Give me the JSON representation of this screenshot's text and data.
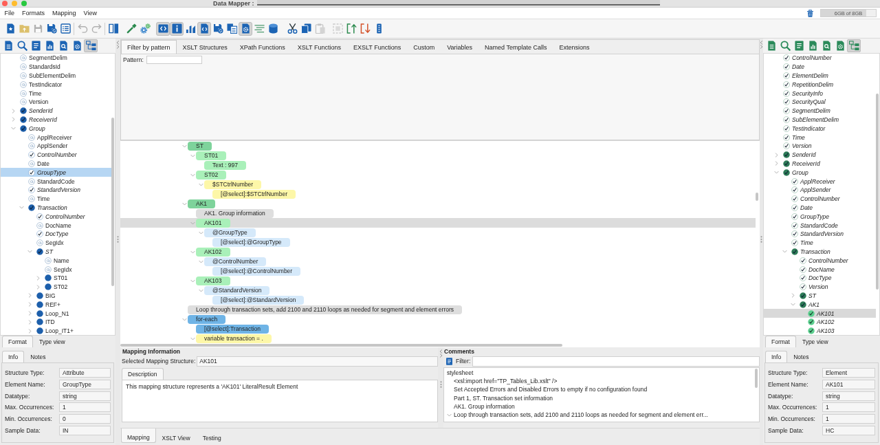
{
  "window": {
    "title": "Data Mapper :"
  },
  "menu": [
    "File",
    "Formats",
    "Mapping",
    "View"
  ],
  "memory": {
    "level": 0.82,
    "reading": "6GB of 8GB"
  },
  "toolbar": [
    {
      "on": false,
      "disabled": false
    },
    {
      "on": false,
      "disabled": false
    },
    {
      "on": false,
      "disabled": true
    },
    {
      "on": false,
      "disabled": false
    },
    {
      "on": false,
      "disabled": false
    },
    {
      "on": false,
      "disabled": true
    },
    {
      "on": false,
      "disabled": true
    },
    {
      "on": false,
      "disabled": false
    },
    {
      "on": false,
      "disabled": false
    },
    {
      "on": false,
      "disabled": false
    },
    {
      "on": true,
      "disabled": false
    },
    {
      "on": true,
      "disabled": false
    },
    {
      "on": false,
      "disabled": false
    },
    {
      "on": true,
      "disabled": false
    },
    {
      "on": false,
      "disabled": false
    },
    {
      "on": false,
      "disabled": false
    },
    {
      "on": true,
      "disabled": false
    },
    {
      "on": false,
      "disabled": false
    },
    {
      "on": false,
      "disabled": false
    },
    {
      "on": false,
      "disabled": false
    },
    {
      "on": false,
      "disabled": false
    },
    {
      "on": false,
      "disabled": true
    },
    {
      "on": false,
      "disabled": true
    },
    {
      "on": false,
      "disabled": false
    },
    {
      "on": false,
      "disabled": false
    },
    {
      "on": false,
      "disabled": false
    }
  ],
  "source_panel": {
    "tools": [
      {
        "on": false
      },
      {
        "on": false
      },
      {
        "on": false
      },
      {
        "on": false
      },
      {
        "on": false
      },
      {
        "on": false
      },
      {
        "on": true
      }
    ],
    "tree": [
      {
        "label": "SegmentDelim",
        "kind": "attribute",
        "selected": false
      },
      {
        "label": "StandardsId",
        "kind": "attribute",
        "selected": false
      },
      {
        "label": "SubElementDelim",
        "kind": "attribute",
        "selected": false
      },
      {
        "label": "TestIndicator",
        "kind": "attribute",
        "selected": false
      },
      {
        "label": "Time",
        "kind": "attribute",
        "selected": false
      },
      {
        "label": "Version",
        "kind": "attribute",
        "selected": false
      },
      {
        "label": "SenderId",
        "kind": "mapped-element",
        "expanded": false,
        "selected": false
      },
      {
        "label": "ReceiverId",
        "kind": "mapped-element",
        "expanded": false,
        "selected": false
      },
      {
        "label": "Group",
        "kind": "mapped-element",
        "expanded": true,
        "selected": false,
        "children": [
          {
            "label": "ApplReceiver",
            "kind": "attribute",
            "selected": false
          },
          {
            "label": "ApplSender",
            "kind": "attribute",
            "selected": false
          },
          {
            "label": "ControlNumber",
            "kind": "mapped-attribute",
            "selected": false
          },
          {
            "label": "Date",
            "kind": "attribute",
            "selected": false
          },
          {
            "label": "GroupType",
            "kind": "mapped-attribute",
            "selected": true
          },
          {
            "label": "StandardCode",
            "kind": "attribute",
            "selected": false
          },
          {
            "label": "StandardVersion",
            "kind": "mapped-attribute",
            "selected": false
          },
          {
            "label": "Time",
            "kind": "attribute",
            "selected": false
          },
          {
            "label": "Transaction",
            "kind": "mapped-element",
            "expanded": true,
            "selected": false,
            "children": [
              {
                "label": "ControlNumber",
                "kind": "mapped-attribute",
                "selected": false
              },
              {
                "label": "DocName",
                "kind": "attribute",
                "selected": false
              },
              {
                "label": "DocType",
                "kind": "mapped-attribute",
                "selected": false
              },
              {
                "label": "SegIdx",
                "kind": "attribute",
                "selected": false
              },
              {
                "label": "ST",
                "kind": "mapped-element",
                "expanded": true,
                "selected": false,
                "children": [
                  {
                    "label": "Name",
                    "kind": "attribute",
                    "selected": false
                  },
                  {
                    "label": "SegIdx",
                    "kind": "attribute",
                    "selected": false
                  },
                  {
                    "label": "ST01",
                    "kind": "element",
                    "expanded": false,
                    "selected": false
                  },
                  {
                    "label": "ST02",
                    "kind": "element",
                    "expanded": false,
                    "selected": false
                  }
                ]
              },
              {
                "label": "BIG",
                "kind": "element",
                "expanded": false,
                "selected": false
              },
              {
                "label": "REF+",
                "kind": "element",
                "expanded": false,
                "selected": false
              },
              {
                "label": "Loop_N1",
                "kind": "element",
                "expanded": false,
                "selected": false
              },
              {
                "label": "ITD",
                "kind": "element",
                "expanded": false,
                "selected": false
              },
              {
                "label": "Loop_IT1+",
                "kind": "element",
                "expanded": false,
                "selected": false
              }
            ]
          }
        ]
      }
    ],
    "view_tabs": [
      {
        "label": "Format",
        "selected": true
      },
      {
        "label": "Type view",
        "selected": false
      }
    ],
    "info_tabs": [
      {
        "label": "Info",
        "selected": true
      },
      {
        "label": "Notes",
        "selected": false
      }
    ],
    "properties": [
      {
        "label": "Structure Type:",
        "value": "Attribute"
      },
      {
        "label": "Element Name:",
        "value": "GroupType"
      },
      {
        "label": "Datatype:",
        "value": "string"
      },
      {
        "label": "Max. Occurrences:",
        "value": "1"
      },
      {
        "label": "Min. Occurrences:",
        "value": "0"
      },
      {
        "label": "Sample Data:",
        "value": "IN"
      }
    ]
  },
  "palette": {
    "tabs": [
      {
        "label": "Filter by pattern",
        "selected": true
      },
      {
        "label": "XSLT Structures",
        "selected": false
      },
      {
        "label": "XPath Functions",
        "selected": false
      },
      {
        "label": "XSLT Functions",
        "selected": false
      },
      {
        "label": "EXSLT Functions",
        "selected": false
      },
      {
        "label": "Custom",
        "selected": false
      },
      {
        "label": "Variables",
        "selected": false
      },
      {
        "label": "Named Template Calls",
        "selected": false
      },
      {
        "label": "Extensions",
        "selected": false
      }
    ],
    "pattern_label": "Pattern:"
  },
  "mapping": {
    "nodes": [
      {
        "label": "ST",
        "color": "#7ed39b",
        "expanded": true,
        "selected": false,
        "children": [
          {
            "label": "ST01",
            "color": "#a9f0b9",
            "expanded": true,
            "selected": false,
            "children": [
              {
                "label": "Text : 997",
                "color": "#a9f0b9",
                "selected": false
              }
            ]
          },
          {
            "label": "ST02",
            "color": "#a9f0b9",
            "expanded": true,
            "selected": false,
            "children": [
              {
                "label": "$STCtrlNumber",
                "color": "#fdf7a8",
                "expanded": true,
                "selected": false,
                "children": [
                  {
                    "label": "[@select]:$STCtrlNumber",
                    "color": "#fdf7a8",
                    "selected": false
                  }
                ]
              }
            ]
          }
        ]
      },
      {
        "label": "AK1",
        "color": "#7ed39b",
        "expanded": true,
        "selected": false,
        "children": [
          {
            "label": "AK1. Group information",
            "color": "#dedede",
            "selected": false
          },
          {
            "label": "AK101",
            "color": "#a9f0b9",
            "expanded": true,
            "selected": true,
            "children": [
              {
                "label": "@GroupType",
                "color": "#d5e9fa",
                "expanded": true,
                "selected": false,
                "children": [
                  {
                    "label": "[@select]:@GroupType",
                    "color": "#d5e9fa",
                    "selected": false
                  }
                ]
              }
            ]
          },
          {
            "label": "AK102",
            "color": "#a9f0b9",
            "expanded": true,
            "selected": false,
            "children": [
              {
                "label": "@ControlNumber",
                "color": "#d5e9fa",
                "expanded": true,
                "selected": false,
                "children": [
                  {
                    "label": "[@select]:@ControlNumber",
                    "color": "#d5e9fa",
                    "selected": false
                  }
                ]
              }
            ]
          },
          {
            "label": "AK103",
            "color": "#a9f0b9",
            "expanded": true,
            "selected": false,
            "children": [
              {
                "label": "@StandardVersion",
                "color": "#d5e9fa",
                "expanded": true,
                "selected": false,
                "children": [
                  {
                    "label": "[@select]:@StandardVersion",
                    "color": "#d5e9fa",
                    "selected": false
                  }
                ]
              }
            ]
          }
        ]
      },
      {
        "label": "Loop through transaction sets, add 2100 and 2110 loops as needed for segment and element errors",
        "color": "#dedede",
        "selected": false
      },
      {
        "label": "for-each",
        "color": "#6fb4e6",
        "expanded": true,
        "selected": false,
        "children": [
          {
            "label": "[@select]:Transaction",
            "color": "#6fb4e6",
            "selected": false
          },
          {
            "label": "variable transaction = .",
            "color": "#fdf7a8",
            "expanded": true,
            "selected": false
          }
        ]
      }
    ]
  },
  "mapping_info": {
    "title": "Mapping Information",
    "structure_label": "Selected Mapping Structure:",
    "structure": "AK101",
    "tabs": [
      {
        "label": "Description",
        "selected": true
      }
    ],
    "description": "This mapping structure represents a 'AK101' LiteralResult Element"
  },
  "comments": {
    "title": "Comments",
    "filter_label": "Filter:",
    "items": [
      {
        "label": "stylesheet",
        "selected": false,
        "children": [
          {
            "label": "<xsl:import href=\"TP_Tables_Lib.xslt\" />",
            "selected": false
          },
          {
            "label": "Set Accepted Errors and Disabled Errors to empty if no configuration found",
            "selected": false
          },
          {
            "label": "Part 1, ST. Transaction set information",
            "selected": false
          },
          {
            "label": "AK1. Group information",
            "selected": false
          },
          {
            "label": "Loop through transaction sets, add 2100 and 2110 loops as needed for segment and element err...",
            "expanded": true,
            "selected": false
          }
        ]
      }
    ]
  },
  "bottom_tabs": [
    {
      "label": "Mapping",
      "selected": true
    },
    {
      "label": "XSLT View",
      "selected": false
    },
    {
      "label": "Testing",
      "selected": false
    }
  ],
  "target_panel": {
    "tools": [
      {
        "on": false
      },
      {
        "on": false
      },
      {
        "on": false
      },
      {
        "on": false
      },
      {
        "on": false
      },
      {
        "on": false
      },
      {
        "on": true
      }
    ],
    "tree": [
      {
        "label": "ControlNumber",
        "kind": "mapped-attribute",
        "selected": false
      },
      {
        "label": "Date",
        "kind": "mapped-attribute",
        "selected": false
      },
      {
        "label": "ElementDelim",
        "kind": "mapped-attribute",
        "selected": false
      },
      {
        "label": "RepetitionDelim",
        "kind": "mapped-attribute",
        "selected": false
      },
      {
        "label": "SecurityInfo",
        "kind": "mapped-attribute",
        "selected": false
      },
      {
        "label": "SecurityQual",
        "kind": "mapped-attribute",
        "selected": false
      },
      {
        "label": "SegmentDelim",
        "kind": "mapped-attribute",
        "selected": false
      },
      {
        "label": "SubElementDelim",
        "kind": "mapped-attribute",
        "selected": false
      },
      {
        "label": "TestIndicator",
        "kind": "mapped-attribute",
        "selected": false
      },
      {
        "label": "Time",
        "kind": "mapped-attribute",
        "selected": false
      },
      {
        "label": "Version",
        "kind": "mapped-attribute",
        "selected": false
      },
      {
        "label": "SenderId",
        "kind": "mapped-element",
        "expanded": false,
        "selected": false
      },
      {
        "label": "ReceiverId",
        "kind": "mapped-element",
        "expanded": false,
        "selected": false
      },
      {
        "label": "Group",
        "kind": "mapped-element",
        "expanded": true,
        "selected": false,
        "children": [
          {
            "label": "ApplReceiver",
            "kind": "mapped-attribute",
            "selected": false
          },
          {
            "label": "ApplSender",
            "kind": "mapped-attribute",
            "selected": false
          },
          {
            "label": "ControlNumber",
            "kind": "mapped-attribute",
            "selected": false
          },
          {
            "label": "Date",
            "kind": "mapped-attribute",
            "selected": false
          },
          {
            "label": "GroupType",
            "kind": "mapped-attribute",
            "selected": false
          },
          {
            "label": "StandardCode",
            "kind": "mapped-attribute",
            "selected": false
          },
          {
            "label": "StandardVersion",
            "kind": "mapped-attribute",
            "selected": false
          },
          {
            "label": "Time",
            "kind": "mapped-attribute",
            "selected": false
          },
          {
            "label": "Transaction",
            "kind": "mapped-element",
            "expanded": true,
            "selected": false,
            "children": [
              {
                "label": "ControlNumber",
                "kind": "mapped-attribute",
                "selected": false
              },
              {
                "label": "DocName",
                "kind": "mapped-attribute",
                "selected": false
              },
              {
                "label": "DocType",
                "kind": "mapped-attribute",
                "selected": false
              },
              {
                "label": "Version",
                "kind": "mapped-attribute",
                "selected": false
              },
              {
                "label": "ST",
                "kind": "mapped-element",
                "expanded": false,
                "selected": false
              },
              {
                "label": "AK1",
                "kind": "mapped-element",
                "expanded": true,
                "selected": false,
                "children": [
                  {
                    "label": "AK101",
                    "kind": "mapped-field",
                    "selected": true
                  },
                  {
                    "label": "AK102",
                    "kind": "mapped-field",
                    "selected": false
                  },
                  {
                    "label": "AK103",
                    "kind": "mapped-field",
                    "selected": false
                  }
                ]
              }
            ]
          }
        ]
      }
    ],
    "view_tabs": [
      {
        "label": "Format",
        "selected": true
      },
      {
        "label": "Type view",
        "selected": false
      }
    ],
    "info_tabs": [
      {
        "label": "Info",
        "selected": true
      },
      {
        "label": "Notes",
        "selected": false
      }
    ],
    "properties": [
      {
        "label": "Structure Type:",
        "value": "Element"
      },
      {
        "label": "Element Name:",
        "value": "AK101"
      },
      {
        "label": "Datatype:",
        "value": "string"
      },
      {
        "label": "Max. Occurrences:",
        "value": "1"
      },
      {
        "label": "Min. Occurrences:",
        "value": "1"
      },
      {
        "label": "Sample Data:",
        "value": "HC"
      }
    ]
  }
}
